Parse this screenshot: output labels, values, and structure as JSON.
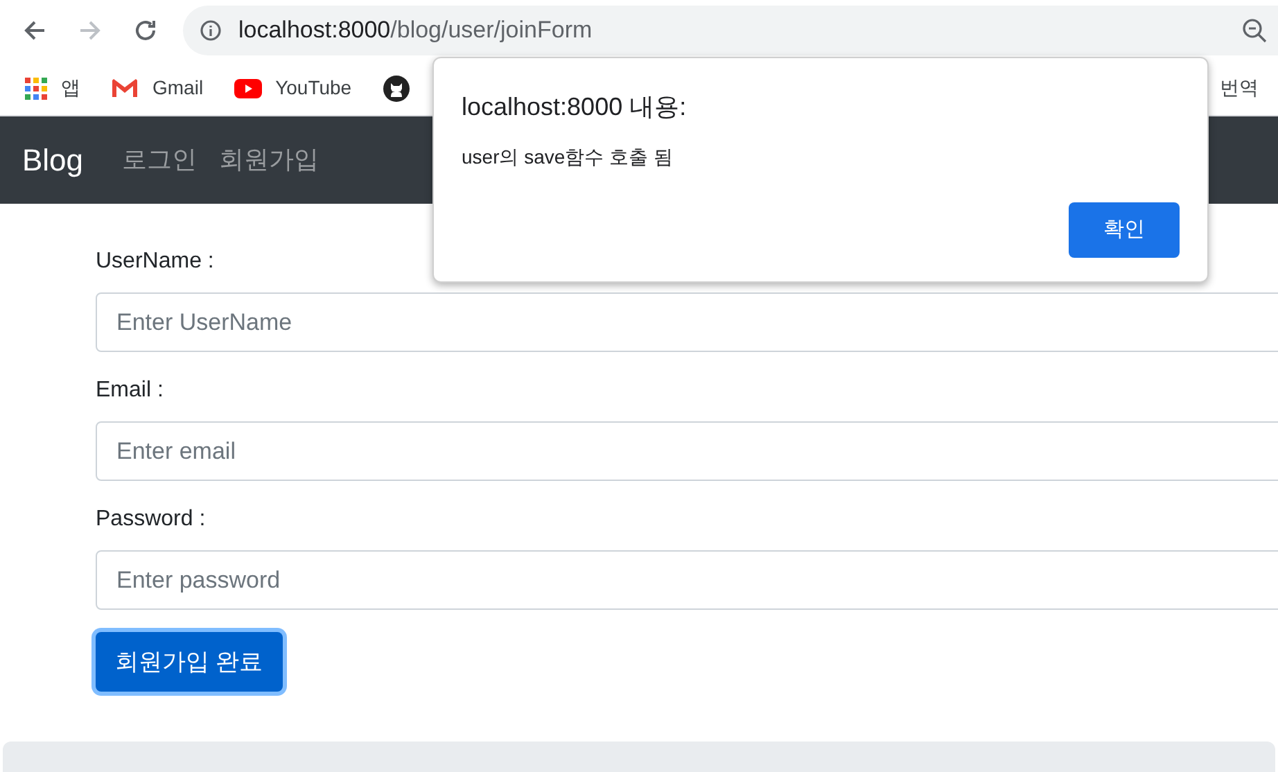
{
  "browser": {
    "url_host": "localhost:8000",
    "url_path": "/blog/user/joinForm"
  },
  "bookmarks": [
    {
      "kind": "apps",
      "label": "앱"
    },
    {
      "kind": "gmail",
      "label": "Gmail"
    },
    {
      "kind": "youtube",
      "label": "YouTube"
    },
    {
      "kind": "github"
    },
    {
      "kind": "translate",
      "label": "번역"
    }
  ],
  "navbar": {
    "brand": "Blog",
    "links": [
      "로그인",
      "회원가입"
    ]
  },
  "form": {
    "fields": [
      {
        "label": "UserName :",
        "placeholder": "Enter UserName"
      },
      {
        "label": "Email :",
        "placeholder": "Enter email"
      },
      {
        "label": "Password :",
        "placeholder": "Enter password"
      }
    ],
    "submit": "회원가입 완료"
  },
  "dialog": {
    "title": "localhost:8000 내용:",
    "message": "user의 save함수 호출 됨",
    "ok": "확인"
  }
}
